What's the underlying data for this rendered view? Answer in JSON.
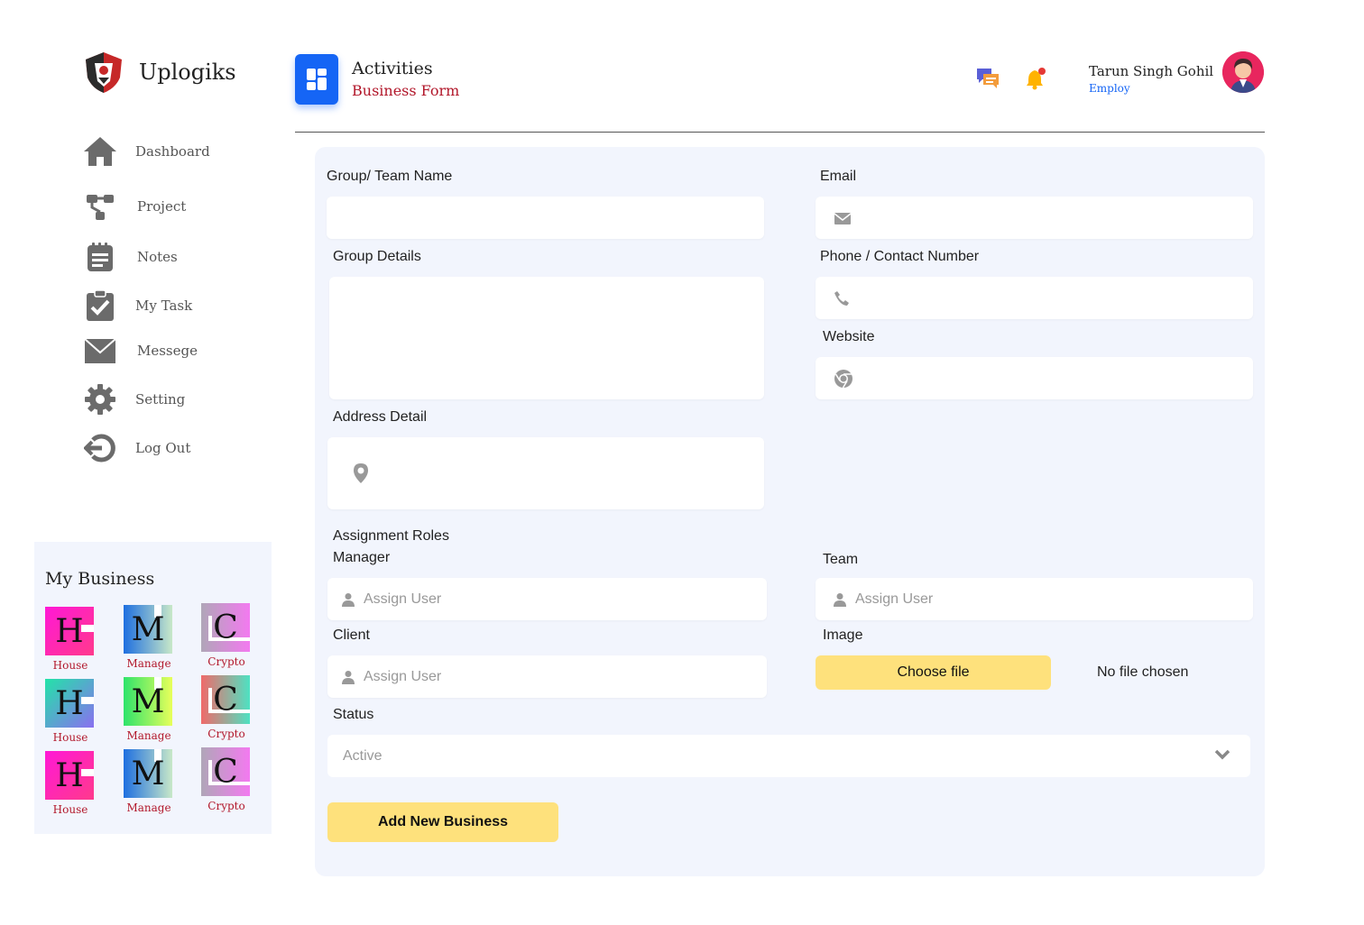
{
  "brand": {
    "name": "Uplogiks"
  },
  "nav": [
    {
      "label": "Dashboard",
      "icon": "home-icon"
    },
    {
      "label": "Project",
      "icon": "project-icon"
    },
    {
      "label": "Notes",
      "icon": "notes-icon"
    },
    {
      "label": "My Task",
      "icon": "task-check-icon"
    },
    {
      "label": "Messege",
      "icon": "mail-icon"
    },
    {
      "label": "Setting",
      "icon": "gear-icon"
    },
    {
      "label": "Log Out",
      "icon": "logout-icon"
    }
  ],
  "business": {
    "title": "My Business",
    "tiles": [
      {
        "letter": "H",
        "caption": "House"
      },
      {
        "letter": "M",
        "caption": "Manage"
      },
      {
        "letter": "C",
        "caption": "Crypto"
      },
      {
        "letter": "H",
        "caption": "House"
      },
      {
        "letter": "M",
        "caption": "Manage"
      },
      {
        "letter": "C",
        "caption": "Crypto"
      },
      {
        "letter": "H",
        "caption": "House"
      },
      {
        "letter": "M",
        "caption": "Manage"
      },
      {
        "letter": "C",
        "caption": "Crypto"
      }
    ]
  },
  "header": {
    "title": "Activities",
    "subtitle": "Business Form",
    "user_name": "Tarun Singh Gohil",
    "user_role": "Employ"
  },
  "form": {
    "group_name_label": "Group/ Team Name",
    "email_label": "Email",
    "group_details_label": "Group Details",
    "phone_label": "Phone / Contact Number",
    "website_label": "Website",
    "address_label": "Address Detail",
    "assignment_label": "Assignment Roles",
    "manager_label": "Manager",
    "team_label": "Team",
    "client_label": "Client",
    "image_label": "Image",
    "assign_placeholder": "Assign User",
    "choose_file": "Choose file",
    "no_file": "No file chosen",
    "status_label": "Status",
    "status_value": "Active",
    "submit": "Add New Business"
  },
  "colors": {
    "accent_blue": "#1565f5",
    "brand_red": "#b2182b",
    "button_yellow": "#fee17c",
    "panel_bg": "#f2f5fd"
  }
}
